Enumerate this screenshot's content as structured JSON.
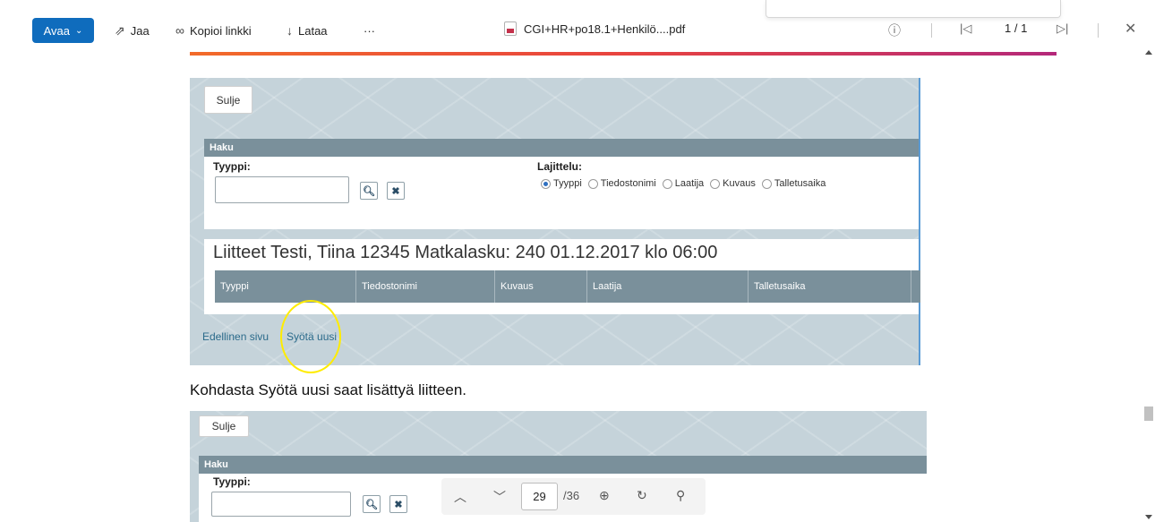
{
  "toolbar": {
    "open_label": "Avaa",
    "share_label": "Jaa",
    "copy_link_label": "Kopioi linkki",
    "download_label": "Lataa",
    "more_label": "···",
    "filename": "CGI+HR+po18.1+Henkilö....pdf",
    "page_indicator": "1 / 1"
  },
  "shot1": {
    "close_label": "Sulje",
    "search_header": "Haku",
    "type_label": "Tyyppi:",
    "sort_label": "Lajittelu:",
    "sort_options": [
      "Tyyppi",
      "Tiedostonimi",
      "Laatija",
      "Kuvaus",
      "Talletusaika"
    ],
    "attachments_title": "Liitteet  Testi, Tiina 12345 Matkalasku: 240 01.12.2017 klo 06:00",
    "columns": [
      "Tyyppi",
      "Tiedostonimi",
      "Kuvaus",
      "Laatija",
      "Talletusaika"
    ],
    "prev_page_label": "Edellinen sivu",
    "new_entry_label": "Syötä uusi"
  },
  "caption": "Kohdasta Syötä uusi saat lisättyä liitteen.",
  "shot2": {
    "close_label": "Sulje",
    "search_header": "Haku",
    "type_label": "Tyyppi:"
  },
  "page_nav": {
    "current_page": "29",
    "total_pages": "/36"
  }
}
